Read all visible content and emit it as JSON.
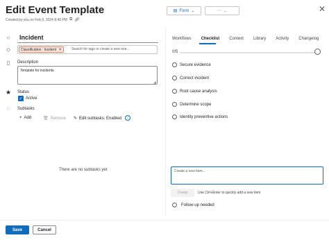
{
  "header": {
    "title": "Edit Event Template",
    "created": "Created by you on Feb 9, 2024 8:40 PM",
    "form_label": "Form",
    "more_label": "⋯",
    "close_icon": "✕"
  },
  "form": {
    "name_value": "Incident",
    "tag_label": "Classification : Incident",
    "tag_placeholder": "Search for tags or create a new one...",
    "description_label": "Description",
    "description_value": "Template for incidents",
    "status_label": "Status",
    "status_value": "Active",
    "subtasks_label": "Subtasks",
    "add_label": "Add",
    "remove_label": "Remove",
    "edit_subtasks_label": "Edit subtasks: Enabled",
    "no_subtasks": "There are no subtasks yet"
  },
  "tabs": [
    "Workflows",
    "Checklist",
    "Context",
    "Library",
    "Activity",
    "Changelog"
  ],
  "active_tab": "Checklist",
  "checklist": {
    "progress_label": "0/5",
    "progress_fraction": 0,
    "items": [
      "Secure evidence",
      "Correct incident",
      "Root cause analysis",
      "Determine scope",
      "Identity preventive actions"
    ],
    "new_item_placeholder": "Create a new item...",
    "create_label": "Create",
    "hint": "Use Ctrl+Enter to quickly add a new item",
    "follow_up": "Follow-up needed"
  },
  "footer": {
    "save_label": "Save",
    "cancel_label": "Cancel"
  },
  "colors": {
    "accent": "#0f6cbd",
    "tag_bg": "#fde7e0",
    "tag_border": "#e8825c"
  }
}
